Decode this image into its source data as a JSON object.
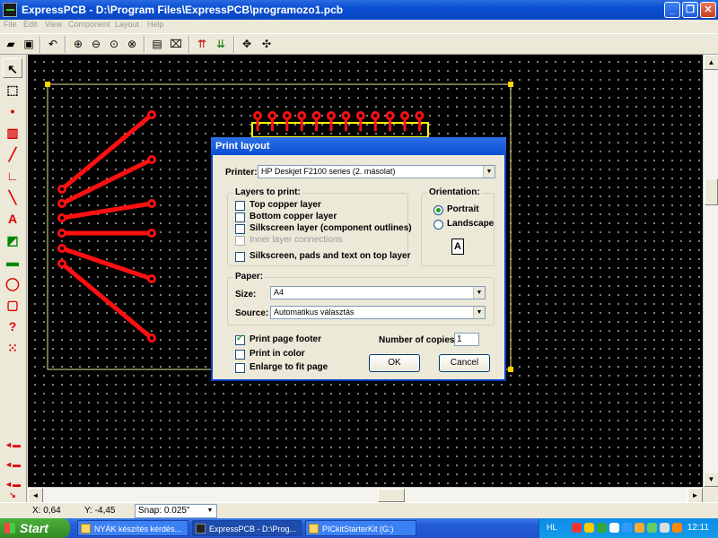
{
  "window": {
    "title": "ExpressPCB - D:\\Program Files\\ExpressPCB\\programozo1.pcb",
    "minimize": "_",
    "maximize": "❐",
    "close": "✕"
  },
  "menu": {
    "items": [
      "File",
      "Edit",
      "View",
      "Component",
      "Layout",
      "Help"
    ]
  },
  "status": {
    "x": "X: 0,64",
    "y": "Y: -4,45",
    "snap": "Snap:  0.025\""
  },
  "dialog": {
    "title": "Print layout",
    "printer_label": "Printer:",
    "printer_value": "HP Deskjet F2100 series (2. másolat)",
    "layers_title": "Layers to print:",
    "layers": [
      {
        "label": "Top copper layer",
        "checked": false,
        "disabled": false
      },
      {
        "label": "Bottom copper layer",
        "checked": false,
        "disabled": false
      },
      {
        "label": "Silkscreen layer (component outlines)",
        "checked": false,
        "disabled": false
      },
      {
        "label": "Inner layer connections",
        "checked": false,
        "disabled": true
      },
      {
        "label": "Silkscreen, pads and text on top layer",
        "checked": false,
        "disabled": false
      }
    ],
    "orientation_title": "Orientation:",
    "portrait": "Portrait",
    "landscape": "Landscape",
    "orientation_selected": "Portrait",
    "orientation_glyph": "A",
    "paper_title": "Paper:",
    "size_label": "Size:",
    "size_value": "A4",
    "source_label": "Source:",
    "source_value": "Automatikus választás",
    "options": [
      {
        "label": "Print page footer",
        "checked": true
      },
      {
        "label": "Print in color",
        "checked": false
      },
      {
        "label": "Enlarge to fit page",
        "checked": false
      }
    ],
    "copies_label": "Number of copies:",
    "copies_value": "1",
    "ok": "OK",
    "cancel": "Cancel"
  },
  "taskbar": {
    "start": "Start",
    "tasks": [
      {
        "label": "NYÁK készítés kérdés...",
        "active": false
      },
      {
        "label": "ExpressPCB - D:\\Prog...",
        "active": true
      },
      {
        "label": "PICkitStarterKit (G:)",
        "active": false
      }
    ],
    "lang": "HL",
    "clock": "12:11"
  },
  "colors": {
    "trace": "#ff1010",
    "board_outline": "#e8e8a0",
    "component_outline": "#ffff00",
    "canvas": "#000000"
  }
}
